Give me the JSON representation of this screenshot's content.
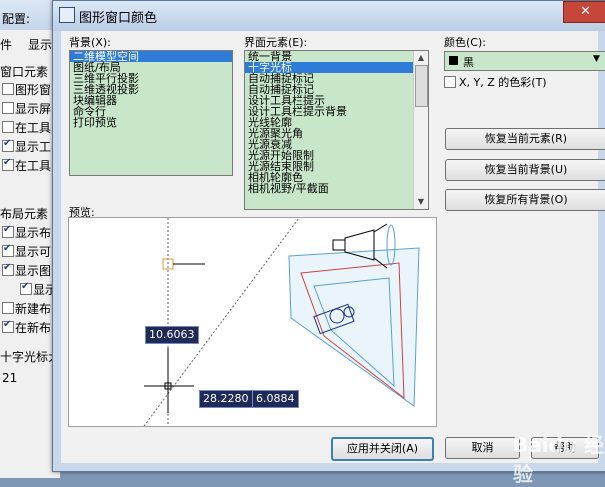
{
  "background_window": {
    "title": "配置:",
    "tab_file": "件",
    "tab_display": "显示",
    "section_window": "窗口元素",
    "rows": [
      {
        "label": "图形窗",
        "checked": false
      },
      {
        "label": "显示屏",
        "checked": false
      },
      {
        "label": "在工具",
        "checked": false
      },
      {
        "label": "显示工",
        "checked": true
      },
      {
        "label": "在工具",
        "checked": true
      }
    ],
    "section_layout": "布局元素",
    "layout_rows": [
      {
        "label": "显示布",
        "checked": true
      },
      {
        "label": "显示可",
        "checked": true
      },
      {
        "label": "显示图",
        "checked": true
      },
      {
        "label": "显示",
        "checked": true
      },
      {
        "label": "新建布",
        "checked": false
      },
      {
        "label": "在新布",
        "checked": true
      }
    ],
    "crosshair_label": "十字光标大",
    "crosshair_value": "21"
  },
  "dialog": {
    "title": "图形窗口颜色",
    "close": "✕",
    "context_label": "背景(X):",
    "context_items": [
      {
        "text": "二维模型空间",
        "selected": true
      },
      {
        "text": "图纸/布局",
        "selected": false
      },
      {
        "text": "三维平行投影",
        "selected": false
      },
      {
        "text": "三维透视投影",
        "selected": false
      },
      {
        "text": "块编辑器",
        "selected": false
      },
      {
        "text": "命令行",
        "selected": false
      },
      {
        "text": "打印预览",
        "selected": false
      }
    ],
    "element_label": "界面元素(E):",
    "element_items": [
      {
        "text": "统一背景",
        "selected": false
      },
      {
        "text": "十字光标",
        "selected": true
      },
      {
        "text": "自动捕捉标记",
        "selected": false
      },
      {
        "text": "自动捕捉标记",
        "selected": false
      },
      {
        "text": "设计工具栏提示",
        "selected": false
      },
      {
        "text": "设计工具栏提示背景",
        "selected": false
      },
      {
        "text": "光线轮廓",
        "selected": false
      },
      {
        "text": "光源聚光角",
        "selected": false
      },
      {
        "text": "光源衰减",
        "selected": false
      },
      {
        "text": "光源开始限制",
        "selected": false
      },
      {
        "text": "光源结束限制",
        "selected": false
      },
      {
        "text": "相机轮廓色",
        "selected": false
      },
      {
        "text": "相机视野/平截面",
        "selected": false
      }
    ],
    "color_label": "颜色(C):",
    "color_value": "黑",
    "color_swatch": "#000000",
    "xyz_checkbox_label": "X, Y, Z 的色彩(T)",
    "restore_element": "恢复当前元素(R)",
    "restore_context": "恢复当前背景(U)",
    "restore_all": "恢复所有背景(O)",
    "preview_label": "预览:",
    "preview_values": {
      "dim1": "10.6063",
      "dim2": "28.2280",
      "dim3": "6.0884"
    },
    "apply_close": "应用并关闭(A)",
    "cancel": "取消",
    "help": "帮助",
    "watermark": "Baidu 经验"
  }
}
